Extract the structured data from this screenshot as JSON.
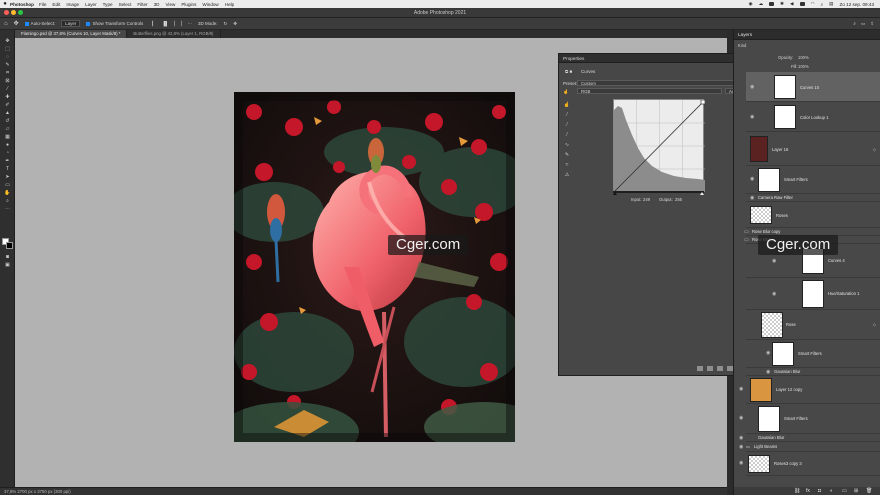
{
  "menubar": {
    "app": "Photoshop",
    "menus": [
      "File",
      "Edit",
      "Image",
      "Layer",
      "Type",
      "Select",
      "Filter",
      "3D",
      "View",
      "Plugins",
      "Window",
      "Help"
    ],
    "clock": "Zo 12 sep.  09:43"
  },
  "window": {
    "title": "Adobe Photoshop 2021"
  },
  "options": {
    "auto_select": "Auto-Select:",
    "auto_select_value": "Layer",
    "show_transform": "Show Transform Controls",
    "mode_3d": "3D Mode:"
  },
  "tabs": [
    {
      "label": "Flamingo.psd @ 37,8% (Curves 10, Layer Mask/8) *"
    },
    {
      "label": "Butterflies.png @ 42,8% (Layer 1, RGB/8)"
    }
  ],
  "status": {
    "text": "37,8%    2700 px x 3750 px (300 ppi)"
  },
  "properties": {
    "title": "Properties",
    "adjustment": "Curves",
    "preset_label": "Preset:",
    "preset_value": "Custom",
    "channel": "RGB",
    "auto_label": "Auto",
    "input_label": "Input:",
    "input_value": "249",
    "output_label": "Output:",
    "output_value": "255"
  },
  "layers": {
    "title": "Layers",
    "kind_label": "Kind",
    "opacity_label": "Opacity:",
    "opacity_value": "100%",
    "fill_label": "Fill:",
    "fill_value": "100%",
    "items": [
      {
        "name": "Curves 10"
      },
      {
        "name": "Color Lookup 1"
      },
      {
        "name": "Layer 16"
      },
      {
        "name": "Smart Filters"
      },
      {
        "name": "Camera Raw Filter"
      },
      {
        "name": "Roses"
      },
      {
        "name": "Rose Blur copy"
      },
      {
        "name": "Rose Blur"
      },
      {
        "name": "Curves 4"
      },
      {
        "name": "Hue/Saturation 1"
      },
      {
        "name": "Rose"
      },
      {
        "name": "Smart Filters"
      },
      {
        "name": "Gaussian Blur"
      },
      {
        "name": "Layer 12 copy"
      },
      {
        "name": "Smart Filters"
      },
      {
        "name": "Gaussian Blur"
      },
      {
        "name": "Light Beams"
      },
      {
        "name": "Roses3 copy 3"
      }
    ]
  },
  "watermark": {
    "text": "Cger.com"
  }
}
